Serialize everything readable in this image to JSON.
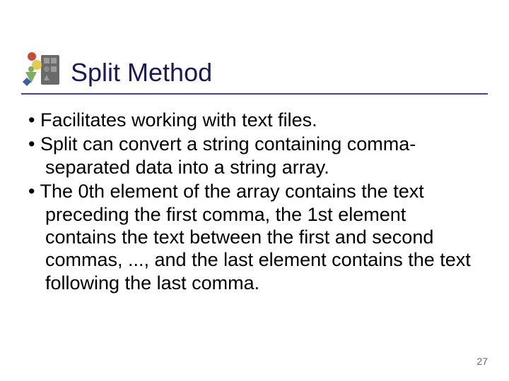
{
  "header": {
    "title": "Split Method"
  },
  "bullets": [
    "Facilitates working with text files.",
    "Split can convert a string containing comma-separated data into a string array.",
    "The 0th element of the array contains the text preceding the first comma, the 1st element contains the text between the first and second commas, ..., and the last element contains the text following the last comma."
  ],
  "page_number": "27"
}
